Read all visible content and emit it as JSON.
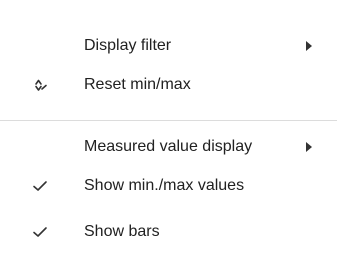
{
  "menu": {
    "items": [
      {
        "label": "Display filter",
        "icon": "",
        "submenu": true
      },
      {
        "label": "Reset min/max",
        "icon": "reset-minmax-icon",
        "submenu": false
      },
      {
        "label": "Measured value display",
        "icon": "",
        "submenu": true
      },
      {
        "label": "Show min./max values",
        "icon": "checkmark-icon",
        "checked": true,
        "submenu": false
      },
      {
        "label": "Show bars",
        "icon": "checkmark-icon",
        "checked": true,
        "submenu": false
      }
    ]
  },
  "colors": {
    "text": "#212121",
    "icon": "#333333",
    "separator": "#dcdcdc",
    "background": "#ffffff"
  }
}
